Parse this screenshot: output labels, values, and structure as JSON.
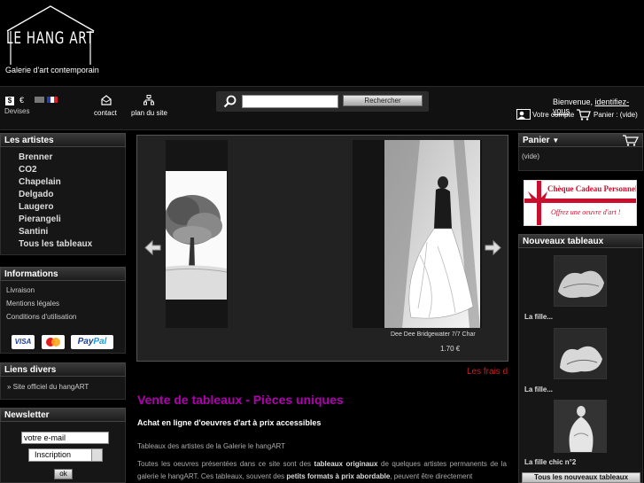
{
  "header": {
    "logo_title": "LE HANG ART",
    "logo_subtitle": "Galerie d'art contemporain"
  },
  "toolbar": {
    "currency_dollar": "$",
    "currency_euro": "€",
    "devises_label": "Devises",
    "contact_label": "contact",
    "plan_label": "plan du site",
    "search_placeholder": "",
    "search_button": "Rechercher",
    "welcome_text": "Bienvenue,",
    "login_link": "identifiez-vous",
    "account_label": "Votre compte",
    "cart_label": "Panier : (vide)"
  },
  "sidebar_left": {
    "artists_title": "Les artistes",
    "artists": [
      "Brenner",
      "CO2",
      "Chapelain",
      "Delgado",
      "Laugero",
      "Pierangeli",
      "Santini",
      "Tous les tableaux"
    ],
    "info_title": "Informations",
    "info_links": [
      "Livraison",
      "Mentions légales",
      "Conditions d'utilisation"
    ],
    "payment_visa": "VISA",
    "payment_paypal_1": "Pay",
    "payment_paypal_2": "Pal",
    "links_title": "Liens divers",
    "links": [
      "Site officiel du hangART"
    ],
    "newsletter_title": "Newsletter",
    "newsletter_input": "votre e-mail",
    "newsletter_select": "Inscription",
    "newsletter_ok": "ok"
  },
  "slider": {
    "caption": "Dee Dee Bridgewater 7/7 Char",
    "price": "1.70 €",
    "marquee": "Les frais d"
  },
  "main": {
    "title": "Vente de tableaux - Pièces uniques",
    "subtitle": "Achat en ligne d'oeuvres d'art à prix accessibles",
    "para1": "Tableaux des artistes de la Galerie le hangART",
    "para2_a": "Toutes les oeuvres présentées dans ce site sont des ",
    "para2_b": "tableaux originaux",
    "para2_c": " de quelques artistes permanents de la galerie le hangART. Ces tableaux, souvent des ",
    "para2_d": "petits formats à prix abordable",
    "para2_e": ", peuvent être directement"
  },
  "sidebar_right": {
    "panier_title": "Panier",
    "panier_state": "(vide)",
    "cheque_title": "Chèque Cadeau Personnel",
    "cheque_sub": "Offrez une oeuvre d'art !",
    "new_title": "Nouveaux tableaux",
    "new_items": [
      "La fille...",
      "La fille...",
      "La fille chic n°2"
    ],
    "all_button": "Tous les nouveaux tableaux"
  },
  "colors": {
    "title_magenta": "#b000b0",
    "marquee_red": "#c62020",
    "cheque_red": "#c8102e"
  }
}
